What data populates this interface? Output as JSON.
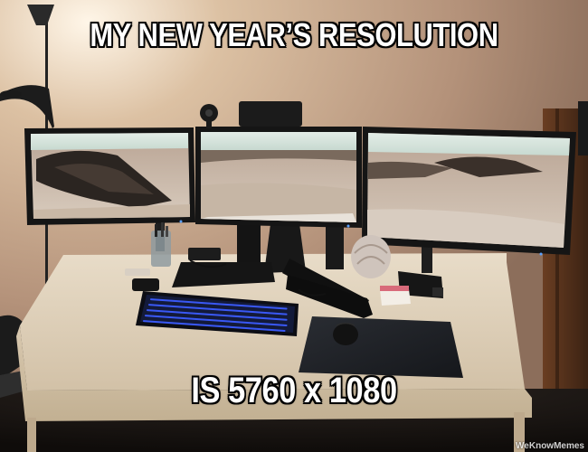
{
  "meme": {
    "top_text": "MY NEW YEAR’S RESOLUTION",
    "bottom_text": "IS 5760 x 1080",
    "watermark": "WeKnowMemes"
  },
  "colors": {
    "wall": "#c9a98a",
    "desk": "#e2d3bc",
    "keyboard_backlight": "#3c5cff",
    "monitor_bezel": "#151515",
    "sky_on_screens": "#cfe0d9"
  },
  "scene": {
    "subject": "desk",
    "objects": [
      "three-monitor-setup",
      "keyboard",
      "mouse",
      "mouse-pad",
      "floor-lamp",
      "webcam",
      "cup-of-pens",
      "seashell",
      "sticky-notes"
    ]
  }
}
